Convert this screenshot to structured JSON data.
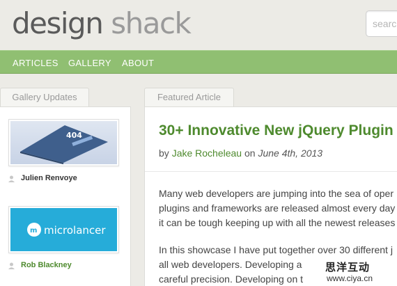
{
  "brand": {
    "word1": "design",
    "word2": "shack"
  },
  "search": {
    "placeholder": "search"
  },
  "nav": {
    "items": [
      "ARTICLES",
      "GALLERY",
      "ABOUT"
    ]
  },
  "tabs": {
    "gallery": "Gallery Updates",
    "featured": "Featured Article"
  },
  "gallery": {
    "items": [
      {
        "author": "Julien Renvoye",
        "thumb_text": "404"
      },
      {
        "author": "Rob Blackney",
        "thumb_text": "microlancer"
      }
    ]
  },
  "article": {
    "title": "30+ Innovative New jQuery Plugin",
    "by": "by",
    "author": "Jake Rocheleau",
    "on": "on",
    "date": "June 4th, 2013",
    "paragraphs": [
      "Many web developers are jumping into the sea of oper",
      "plugins and frameworks are released almost every day",
      "it can be tough keeping up with all the newest releases",
      "In this showcase I have put together over 30 different j",
      "all web developers. Developing a",
      "careful precision. Developing on t"
    ]
  },
  "watermark": {
    "cn": "思洋互动",
    "url": "www.ciya.cn"
  },
  "colors": {
    "nav": "#90bf72",
    "link": "#4e8a2e",
    "background": "#ecebe6"
  }
}
